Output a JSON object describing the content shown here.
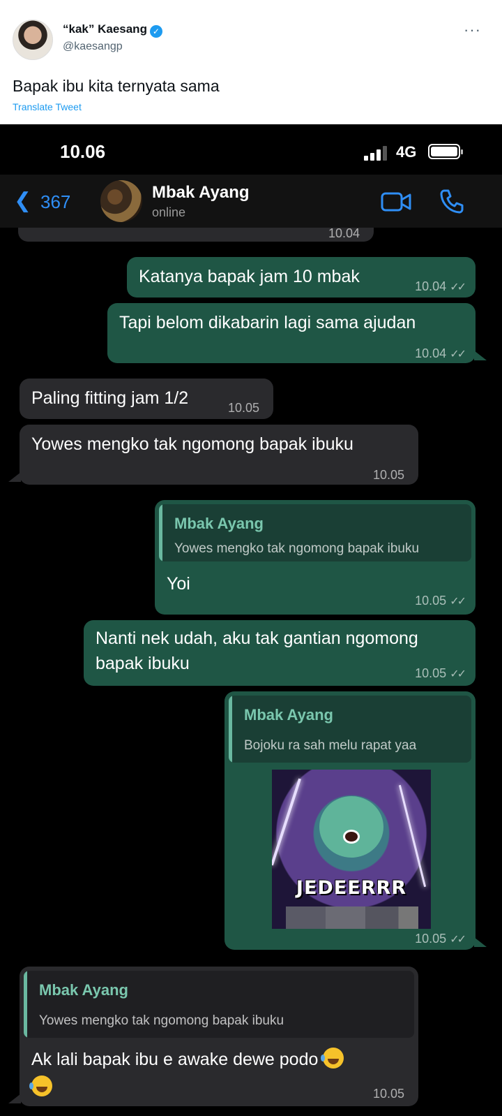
{
  "tweet": {
    "name": "“kak” Kaesang",
    "handle": "@kaesangp",
    "more": "···",
    "text": "Bapak ibu kita ternyata sama",
    "translate": "Translate Tweet"
  },
  "status_bar": {
    "time": "10.06",
    "network": "4G"
  },
  "chat_header": {
    "back_count": "367",
    "contact_name": "Mbak Ayang",
    "contact_status": "online"
  },
  "messages": {
    "partial_time": "10.04",
    "m1": {
      "text": "Katanya bapak jam 10 mbak",
      "time": "10.04"
    },
    "m2": {
      "text": "Tapi belom dikabarin lagi sama ajudan",
      "time": "10.04"
    },
    "m3": {
      "text": "Paling fitting jam 1/2",
      "time": "10.05"
    },
    "m4": {
      "text": "Yowes mengko tak ngomong bapak ibuku",
      "time": "10.05"
    },
    "m5": {
      "quote_name": "Mbak Ayang",
      "quote_text": "Yowes mengko tak ngomong bapak ibuku",
      "text": "Yoi",
      "time": "10.05"
    },
    "m6": {
      "line1": "Nanti nek udah, aku tak gantian ngomong",
      "line2": "bapak ibuku",
      "time": "10.05"
    },
    "m7": {
      "quote_name": "Mbak Ayang",
      "quote_text": "Bojoku ra sah melu rapat yaa",
      "sticker_caption": "JEDEERRR",
      "time": "10.05"
    },
    "m8": {
      "quote_name": "Mbak Ayang",
      "quote_text": "Yowes mengko tak ngomong bapak ibuku",
      "text": "Ak lali bapak ibu e awake dewe podo",
      "time": "10.05"
    }
  }
}
